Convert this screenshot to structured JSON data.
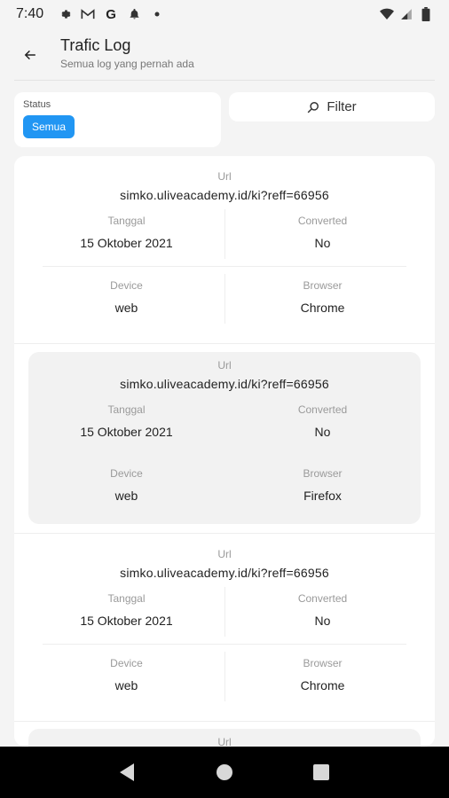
{
  "status_bar": {
    "time": "7:40",
    "icons_left": [
      "gear-icon",
      "gmail-icon",
      "google-icon",
      "notification-icon",
      "dot-icon"
    ],
    "icons_right": [
      "wifi-icon",
      "signal-icon",
      "battery-icon"
    ]
  },
  "header": {
    "title": "Trafic Log",
    "subtitle": "Semua log yang pernah ada"
  },
  "filters": {
    "status_label": "Status",
    "status_chip": "Semua",
    "filter_button": "Filter",
    "accent_color": "#2196f3"
  },
  "labels": {
    "url": "Url",
    "tanggal": "Tanggal",
    "converted": "Converted",
    "device": "Device",
    "browser": "Browser"
  },
  "logs": [
    {
      "url": "simko.uliveacademy.id/ki?reff=66956",
      "tanggal": "15 Oktober 2021",
      "converted": "No",
      "device": "web",
      "browser": "Chrome"
    },
    {
      "url": "simko.uliveacademy.id/ki?reff=66956",
      "tanggal": "15 Oktober 2021",
      "converted": "No",
      "device": "web",
      "browser": "Firefox"
    },
    {
      "url": "simko.uliveacademy.id/ki?reff=66956",
      "tanggal": "15 Oktober 2021",
      "converted": "No",
      "device": "web",
      "browser": "Chrome"
    },
    {
      "url_label_only": true
    }
  ]
}
